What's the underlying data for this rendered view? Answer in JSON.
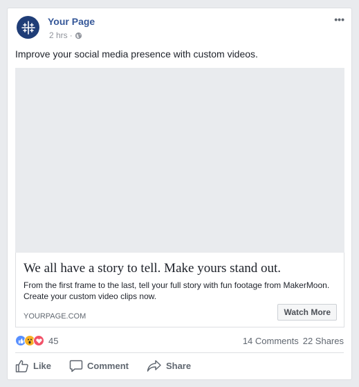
{
  "post": {
    "page_name": "Your Page",
    "timestamp": "2 hrs",
    "separator": "·",
    "privacy_icon": "globe-icon",
    "more_icon": "more-options-icon",
    "more_glyph": "•••",
    "text": "Improve your social media presence with custom videos."
  },
  "link_preview": {
    "headline": "We all have a story to tell. Make yours stand out.",
    "description": "From the first frame to the last, tell your full story with fun footage from MakerMoon. Create your custom video clips now.",
    "domain": "YOURPAGE.COM",
    "cta_label": "Watch More"
  },
  "engagement": {
    "reactions": [
      {
        "type": "like",
        "color": "#5890ff"
      },
      {
        "type": "wow",
        "color": "#f7b125"
      },
      {
        "type": "love",
        "color": "#f25268"
      }
    ],
    "reaction_count": "45",
    "comments": "14 Comments",
    "shares": "22 Shares"
  },
  "actions": [
    {
      "label": "Like",
      "icon": "thumbs-up-icon"
    },
    {
      "label": "Comment",
      "icon": "comment-icon"
    },
    {
      "label": "Share",
      "icon": "share-icon"
    }
  ],
  "colors": {
    "brand_link": "#365899",
    "avatar_bg": "#1f3d77",
    "media_placeholder": "#e9ebee"
  }
}
